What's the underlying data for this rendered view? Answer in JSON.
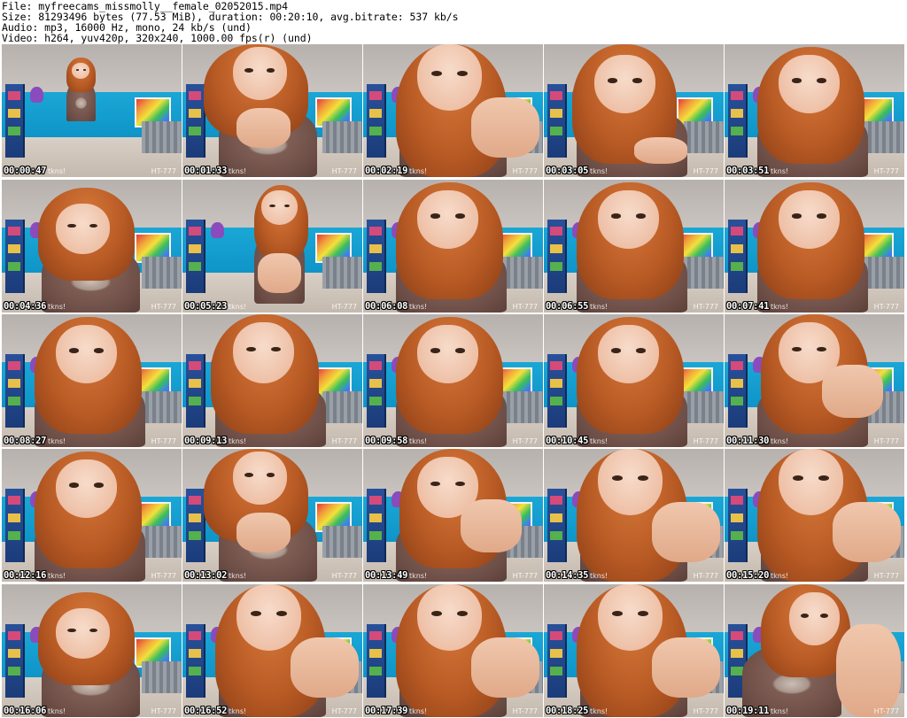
{
  "info": {
    "file_line": "File: myfreecams_missmolly__female_02052015.mp4",
    "size_line": "Size: 81293496 bytes (77.53 MiB), duration: 00:20:10, avg.bitrate: 537 kb/s",
    "audio_line": "Audio: mp3, 16000 Hz, mono, 24 kb/s (und)",
    "video_line": "Video: h264, yuv420p, 320x240, 1000.00 fps(r) (und)"
  },
  "watermark": "HT-777",
  "tip_text": "tkns!",
  "thumbnails": [
    {
      "time": "00:00:47",
      "pose": "room"
    },
    {
      "time": "00:01:33",
      "pose": "lean"
    },
    {
      "time": "00:02:19",
      "pose": "close"
    },
    {
      "time": "00:03:05",
      "pose": "phone"
    },
    {
      "time": "00:03:51",
      "pose": "sit"
    },
    {
      "time": "00:04:36",
      "pose": "bend"
    },
    {
      "time": "00:05:23",
      "pose": "crouch"
    },
    {
      "time": "00:06:08",
      "pose": "sit"
    },
    {
      "time": "00:06:55",
      "pose": "sit"
    },
    {
      "time": "00:07:41",
      "pose": "sit"
    },
    {
      "time": "00:08:27",
      "pose": "sit"
    },
    {
      "time": "00:09:13",
      "pose": "tilt"
    },
    {
      "time": "00:09:58",
      "pose": "sit"
    },
    {
      "time": "00:10:45",
      "pose": "sit"
    },
    {
      "time": "00:11:30",
      "pose": "chin"
    },
    {
      "time": "00:12:16",
      "pose": "sit"
    },
    {
      "time": "00:13:02",
      "pose": "lean"
    },
    {
      "time": "00:13:49",
      "pose": "chin"
    },
    {
      "time": "00:14:35",
      "pose": "close"
    },
    {
      "time": "00:15:20",
      "pose": "close"
    },
    {
      "time": "00:16:06",
      "pose": "bend"
    },
    {
      "time": "00:16:52",
      "pose": "close"
    },
    {
      "time": "00:17:39",
      "pose": "close"
    },
    {
      "time": "00:18:25",
      "pose": "close"
    },
    {
      "time": "00:19:11",
      "pose": "fur"
    }
  ]
}
